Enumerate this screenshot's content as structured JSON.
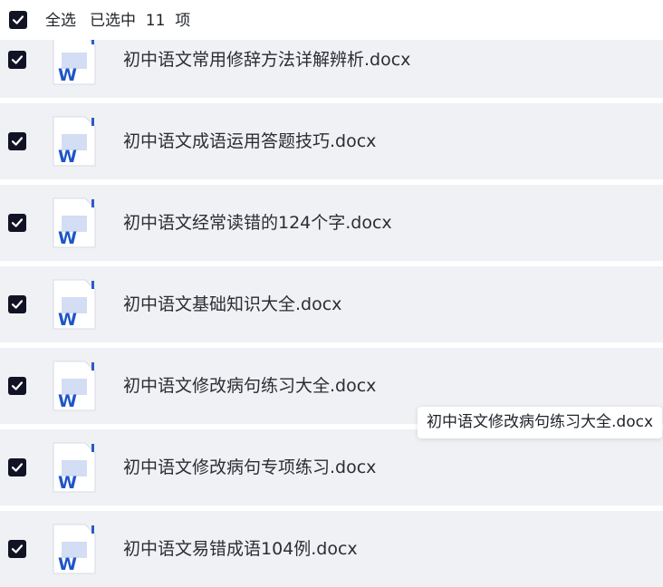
{
  "header": {
    "select_all_label": "全选",
    "selected_count_text": "已选中  11  项",
    "select_all_checked": true
  },
  "files": [
    {
      "name": "初中语文常用修辞方法详解辨析.docx",
      "checked": true,
      "icon": "word-doc-icon"
    },
    {
      "name": "初中语文成语运用答题技巧.docx",
      "checked": true,
      "icon": "word-doc-icon"
    },
    {
      "name": "初中语文经常读错的124个字.docx",
      "checked": true,
      "icon": "word-doc-icon"
    },
    {
      "name": "初中语文基础知识大全.docx",
      "checked": true,
      "icon": "word-doc-icon"
    },
    {
      "name": "初中语文修改病句练习大全.docx",
      "checked": true,
      "icon": "word-doc-icon"
    },
    {
      "name": "初中语文修改病句专项练习.docx",
      "checked": true,
      "icon": "word-doc-icon"
    },
    {
      "name": "初中语文易错成语104例.docx",
      "checked": true,
      "icon": "word-doc-icon"
    }
  ],
  "tooltip": {
    "text": "初中语文修改病句练习大全.docx"
  },
  "colors": {
    "row_background": "#f0f1f4",
    "checkbox_fill": "#111325",
    "word_blue": "#1d56c7"
  }
}
